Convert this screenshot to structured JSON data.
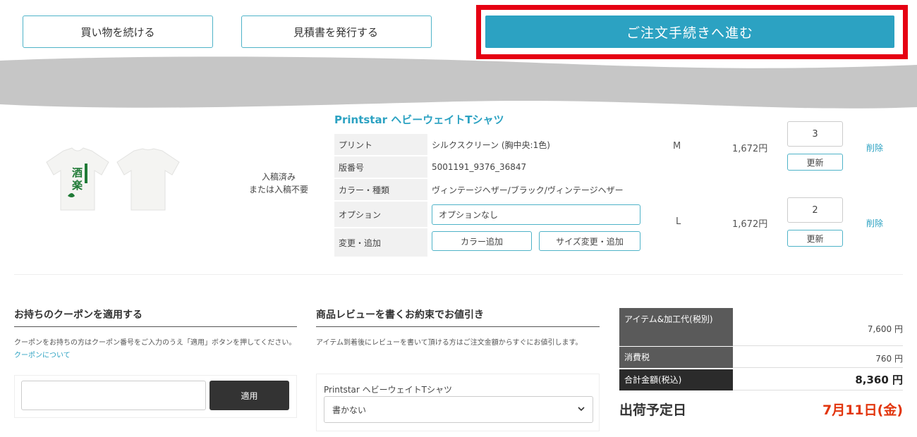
{
  "actions": {
    "continue_shopping": "買い物を続ける",
    "issue_quote": "見積書を発行する",
    "checkout": "ご注文手続きへ進む"
  },
  "product": {
    "name": "Printstar ヘビーウェイトTシャツ",
    "upload_status_line1": "入稿済み",
    "upload_status_line2": "または入稿不要",
    "specs": {
      "print_label": "プリント",
      "print_value": "シルクスクリーン (胸中央:1色)",
      "plate_label": "版番号",
      "plate_value": "5001191_9376_36847",
      "color_label": "カラー・種類",
      "color_value": "ヴィンテージヘザー/ブラック/ヴィンテージヘザー",
      "option_label": "オプション",
      "option_value": "オプションなし",
      "change_label": "変更・追加",
      "add_color": "カラー追加",
      "change_size": "サイズ変更・追加"
    },
    "lines": [
      {
        "size": "M",
        "price": "1,672円",
        "qty": "3",
        "update": "更新",
        "delete": "削除"
      },
      {
        "size": "L",
        "price": "1,672円",
        "qty": "2",
        "update": "更新",
        "delete": "削除"
      }
    ]
  },
  "coupon": {
    "title": "お持ちのクーポンを適用する",
    "desc": "クーポンをお持ちの方はクーポン番号をご入力のうえ「適用」ボタンを押してください。",
    "link": "クーポンについて",
    "input_value": "",
    "apply": "適用"
  },
  "review": {
    "title": "商品レビューを書くお約束でお値引き",
    "desc": "アイテム到着後にレビューを書いて頂ける方はご注文金額からすぐにお値引します。",
    "item_label": "Printstar ヘビーウェイトTシャツ",
    "selected": "書かない"
  },
  "totals": {
    "items_label": "アイテム&加工代(税別)",
    "items_value": "7,600 円",
    "tax_label": "消費税",
    "tax_value": "760 円",
    "total_label": "合計金額(税込)",
    "total_value": "8,360 円"
  },
  "shipping": {
    "label": "出荷予定日",
    "date": "7月11日(金)"
  },
  "colors": {
    "accent": "#2ca2c2",
    "highlight": "#e60012",
    "ship_date": "#e2360e"
  }
}
